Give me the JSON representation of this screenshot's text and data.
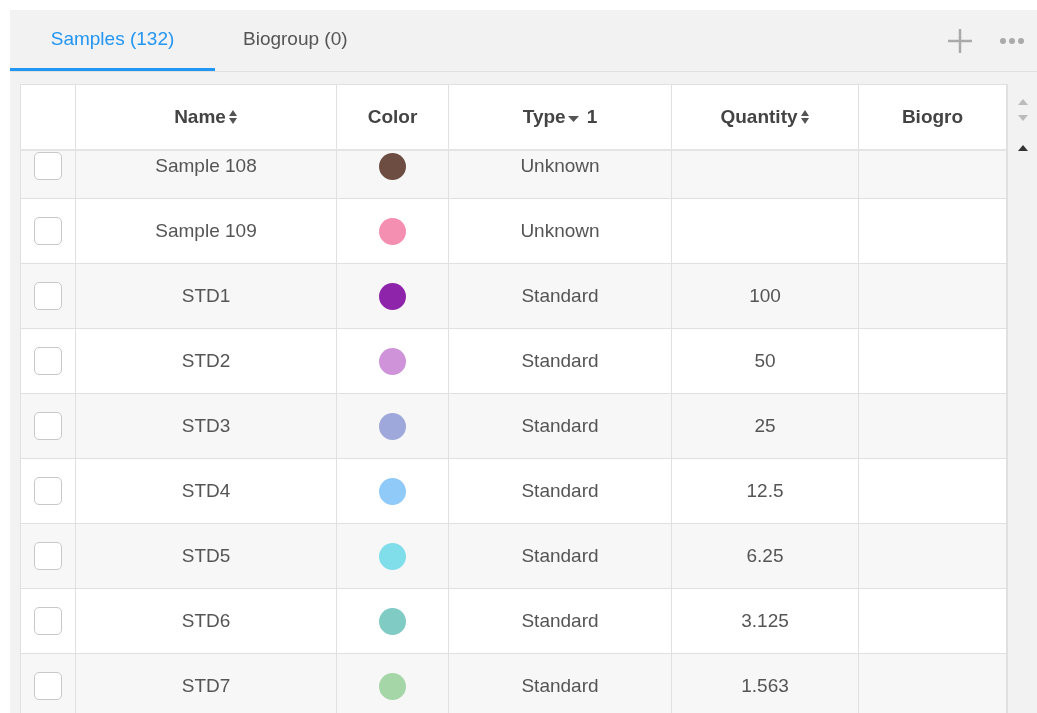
{
  "tabs": [
    {
      "label": "Samples (132)",
      "selected": true
    },
    {
      "label": "Biogroup (0)",
      "selected": false
    }
  ],
  "table": {
    "columns": [
      {
        "label": "Name",
        "kind": "sortable"
      },
      {
        "label": "Color",
        "kind": "plain"
      },
      {
        "label": "Type",
        "kind": "sorted",
        "order": "1"
      },
      {
        "label": "Quantity",
        "kind": "sortable"
      },
      {
        "label": "Biogro",
        "kind": "plain"
      }
    ],
    "rows": [
      {
        "checked": false,
        "name": "Sample 108",
        "color": "#6d4c41",
        "type": "Unknown"
      },
      {
        "checked": false,
        "name": "Sample 109",
        "color": "#f48fb1",
        "type": "Unknown"
      },
      {
        "checked": false,
        "name": "STD1",
        "color": "#8e24aa",
        "type": "Standard",
        "quantity": "100"
      },
      {
        "checked": false,
        "name": "STD2",
        "color": "#ce93d8",
        "type": "Standard",
        "quantity": "50"
      },
      {
        "checked": false,
        "name": "STD3",
        "color": "#9fa8da",
        "type": "Standard",
        "quantity": "25"
      },
      {
        "checked": false,
        "name": "STD4",
        "color": "#90caf9",
        "type": "Standard",
        "quantity": "12.5"
      },
      {
        "checked": false,
        "name": "STD5",
        "color": "#80deea",
        "type": "Standard",
        "quantity": "6.25"
      },
      {
        "checked": false,
        "name": "STD6",
        "color": "#80cbc4",
        "type": "Standard",
        "quantity": "3.125"
      },
      {
        "checked": false,
        "name": "STD7",
        "color": "#a5d6a7",
        "type": "Standard",
        "quantity": "1.563"
      }
    ]
  }
}
